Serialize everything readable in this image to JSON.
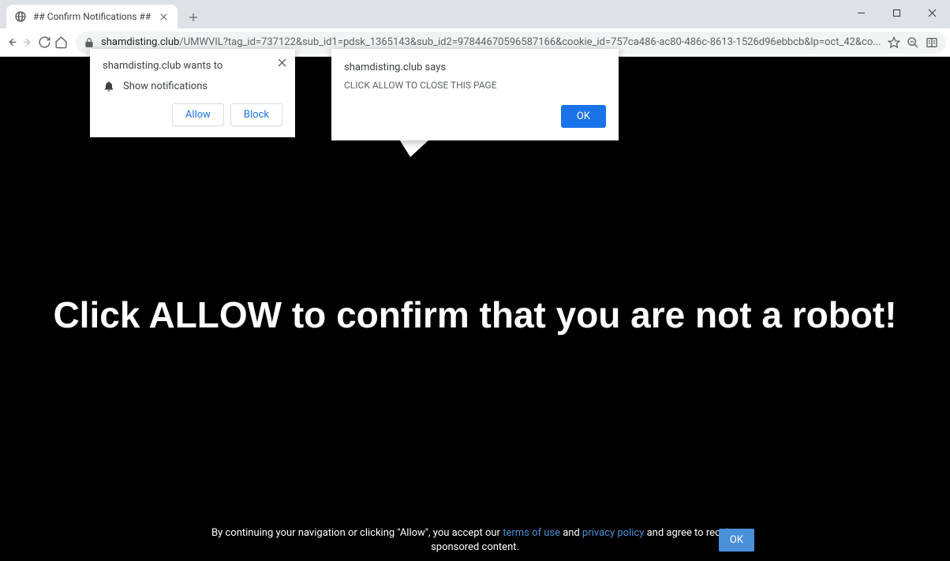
{
  "window": {
    "minimize": "–",
    "maximize": "□",
    "close": "✕"
  },
  "tab": {
    "title": "## Confirm Notifications ##"
  },
  "address": {
    "domain": "shamdisting.club",
    "path": "/UMWVIL?tag_id=737122&sub_id1=pdsk_1365143&sub_id2=97844670596587166&cookie_id=757ca486-ac80-486c-8613-1526d96ebbcb&lp=oct_42&co..."
  },
  "notif_popup": {
    "title": "shamdisting.club wants to",
    "permission_label": "Show notifications",
    "allow_label": "Allow",
    "block_label": "Block"
  },
  "alert": {
    "says": "shamdisting.club says",
    "message": "CLICK ALLOW TO CLOSE THIS PAGE",
    "ok_label": "OK"
  },
  "page": {
    "main_text": "Click ALLOW to confirm that you are not a robot!",
    "footer_pre": "By continuing your navigation or clicking \"Allow\", you accept our ",
    "terms_link": "terms of use",
    "footer_mid": " and ",
    "privacy_link": "privacy policy",
    "footer_post": " and agree to receive sponsored content.",
    "footer_ok": "OK"
  }
}
